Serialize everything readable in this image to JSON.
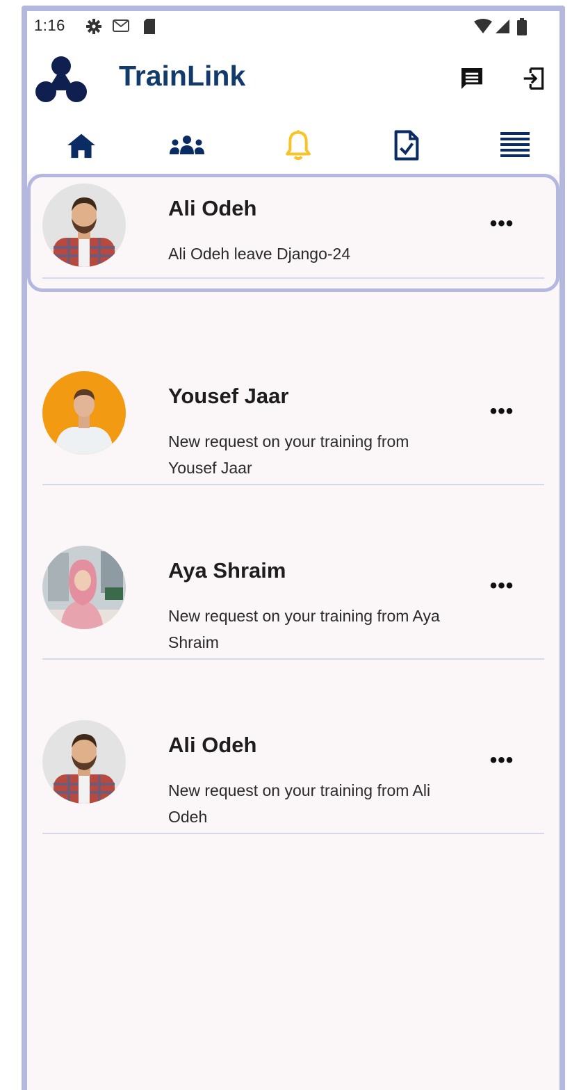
{
  "status_bar": {
    "time": "1:16",
    "icons": [
      "gear-icon",
      "gmail-icon",
      "sd-card-icon",
      "wifi-icon",
      "cell-signal-icon",
      "battery-icon"
    ]
  },
  "header": {
    "title": "TrainLink",
    "brand_color": "#123a6c",
    "actions": [
      "chat-icon",
      "logout-icon"
    ]
  },
  "nav": {
    "items": [
      "home-icon",
      "people-icon",
      "bell-icon",
      "document-check-icon",
      "menu-lines-icon"
    ],
    "active": "bell-icon",
    "active_color": "#f7c325"
  },
  "notifications": [
    {
      "name": "Ali Odeh",
      "message": "Ali Odeh leave Django-24",
      "selected": true,
      "avatar": "man-bearded-plaid-avatar"
    },
    {
      "name": "Yousef Jaar",
      "message": "New request on your training from Yousef Jaar",
      "selected": false,
      "avatar": "man-white-tshirt-avatar"
    },
    {
      "name": "Aya Shraim",
      "message": "New request on your training from Aya Shraim",
      "selected": false,
      "avatar": "woman-hijab-avatar"
    },
    {
      "name": "Ali Odeh",
      "message": "New request on your training from Ali Odeh",
      "selected": false,
      "avatar": "man-bearded-plaid-avatar"
    }
  ],
  "more_label": "•••",
  "colors": {
    "frame_border": "#b4b7de",
    "background": "#fbf6f8"
  }
}
